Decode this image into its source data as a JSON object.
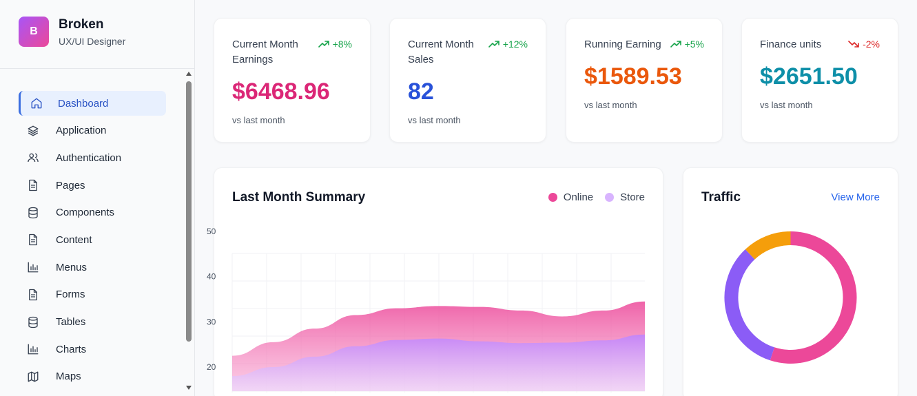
{
  "brand": {
    "initial": "B",
    "name": "Broken",
    "role": "UX/UI Designer"
  },
  "nav": [
    {
      "label": "Dashboard",
      "icon": "home-icon",
      "active": true
    },
    {
      "label": "Application",
      "icon": "layers-icon"
    },
    {
      "label": "Authentication",
      "icon": "users-icon"
    },
    {
      "label": "Pages",
      "icon": "document-icon"
    },
    {
      "label": "Components",
      "icon": "database-icon"
    },
    {
      "label": "Content",
      "icon": "document-icon"
    },
    {
      "label": "Menus",
      "icon": "bar-chart-icon"
    },
    {
      "label": "Forms",
      "icon": "document-icon"
    },
    {
      "label": "Tables",
      "icon": "database-icon"
    },
    {
      "label": "Charts",
      "icon": "bar-chart-icon"
    },
    {
      "label": "Maps",
      "icon": "map-icon"
    }
  ],
  "stats": [
    {
      "title": "Current Month Earnings",
      "change": "+8%",
      "trend": "up",
      "value": "$6468.96",
      "sub": "vs last month",
      "color": "#db2777"
    },
    {
      "title": "Current Month Sales",
      "change": "+12%",
      "trend": "up",
      "value": "82",
      "sub": "vs last month",
      "color": "#2952d9"
    },
    {
      "title": "Running Earning",
      "change": "+5%",
      "trend": "up",
      "value": "$1589.53",
      "sub": "vs last month",
      "color": "#ea580c"
    },
    {
      "title": "Finance units",
      "change": "-2%",
      "trend": "down",
      "value": "$2651.50",
      "sub": "vs last month",
      "color": "#0e8fa8"
    }
  ],
  "summary": {
    "title": "Last Month Summary",
    "legend": [
      {
        "name": "Online",
        "color": "#ec4899"
      },
      {
        "name": "Store",
        "color": "#d8b4fe"
      }
    ]
  },
  "traffic": {
    "title": "Traffic",
    "link": "View More"
  },
  "chart_data": [
    {
      "type": "area",
      "title": "Last Month Summary",
      "y_ticks": [
        20,
        30,
        40,
        50
      ],
      "ylim": [
        15,
        50
      ],
      "grid": true,
      "legend_position": "top-right",
      "series": [
        {
          "name": "Online",
          "values": [
            22.5,
            25.5,
            28.5,
            31.5,
            33,
            33.5,
            33.3,
            32.5,
            31.2,
            32.5,
            34.5
          ],
          "color": "#ec4899"
        },
        {
          "name": "Store",
          "values": [
            18,
            20,
            22.3,
            24.6,
            26,
            26.3,
            25.7,
            25.3,
            25.4,
            25.9,
            27.2
          ],
          "color": "#c084fc"
        }
      ]
    },
    {
      "type": "pie",
      "title": "Traffic",
      "donut": true,
      "slices": [
        {
          "value": 55,
          "color": "#ec4899"
        },
        {
          "value": 33,
          "color": "#8b5cf6"
        },
        {
          "value": 12,
          "color": "#f59e0b"
        }
      ]
    }
  ]
}
